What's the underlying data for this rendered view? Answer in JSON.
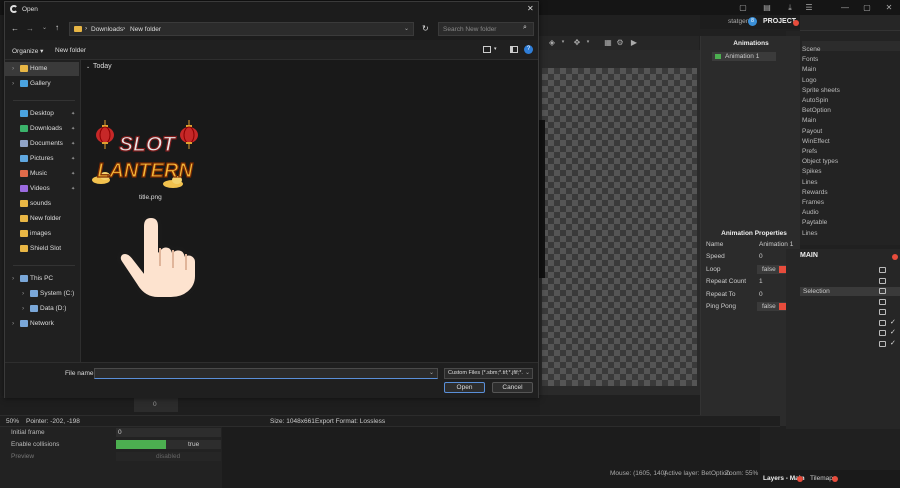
{
  "app": {
    "project_tab": "PROJECT",
    "project_user": "statgen",
    "project_badge": "8",
    "project_items": [
      "Scene",
      "Fonts",
      "Main",
      "Logo",
      "Sprite sheets",
      "AutoSpin",
      "BetOption",
      "Main",
      "Payout",
      "WinEffect",
      "Prefs",
      "Object types",
      "Spikes",
      "Lines",
      "Rewards",
      "Frames",
      "Audio",
      "Paytable",
      "Lines"
    ],
    "animations_title": "Animations",
    "animation_name": "Animation 1",
    "props_title": "Animation Properties",
    "props": [
      {
        "label": "Name",
        "value": "Animation 1"
      },
      {
        "label": "Speed",
        "value": "0"
      },
      {
        "label": "Loop",
        "value": "false"
      },
      {
        "label": "Repeat Count",
        "value": "1"
      },
      {
        "label": "Repeat To",
        "value": "0"
      },
      {
        "label": "Ping Pong",
        "value": "false"
      }
    ],
    "layers_title": "MAIN",
    "layer_selected": "Selection",
    "bottom_left_rows": [
      {
        "label": "Initial frame",
        "value": "0"
      },
      {
        "label": "Enable collisions",
        "value": "true"
      },
      {
        "label": "Preview",
        "value": "disabled"
      }
    ],
    "zoom": "50%",
    "pointer": "Pointer: -202, -198",
    "image_size": "Size: 1048x661",
    "export_format": "Export Format: Lossless",
    "mouse": "Mouse: (1605, 140)",
    "active_layer": "Active layer: BetOption",
    "zoom_right": "Zoom: 55%",
    "tab_layers": "Layers - Main",
    "tab_tilemap": "Tilemap",
    "small_value": "0",
    "colors": {
      "accent_red": "#e74c3c",
      "accent_green": "#4caf50",
      "dialog_bg": "#202020"
    }
  },
  "dialog": {
    "title": "Open",
    "breadcrumb": [
      "Downloads",
      "New folder"
    ],
    "search_placeholder": "Search New folder",
    "organize": "Organize",
    "new_folder": "New folder",
    "group_label": "Today",
    "nav_top": [
      "Home",
      "Gallery"
    ],
    "nav_quick": [
      "Desktop",
      "Downloads",
      "Documents",
      "Pictures",
      "Music",
      "Videos",
      "sounds",
      "New folder",
      "images",
      "Shield Slot"
    ],
    "nav_pc": [
      "This PC",
      "System (C:)",
      "Data (D:)",
      "Network"
    ],
    "file_name": "title.png",
    "thumb_line1": "SLOT",
    "thumb_line2": "LANTERN",
    "file_name_label": "File name:",
    "file_type": "Custom Files (*.sbm;*.tif;*.jfif;*.",
    "open_label": "Open",
    "cancel_label": "Cancel"
  }
}
